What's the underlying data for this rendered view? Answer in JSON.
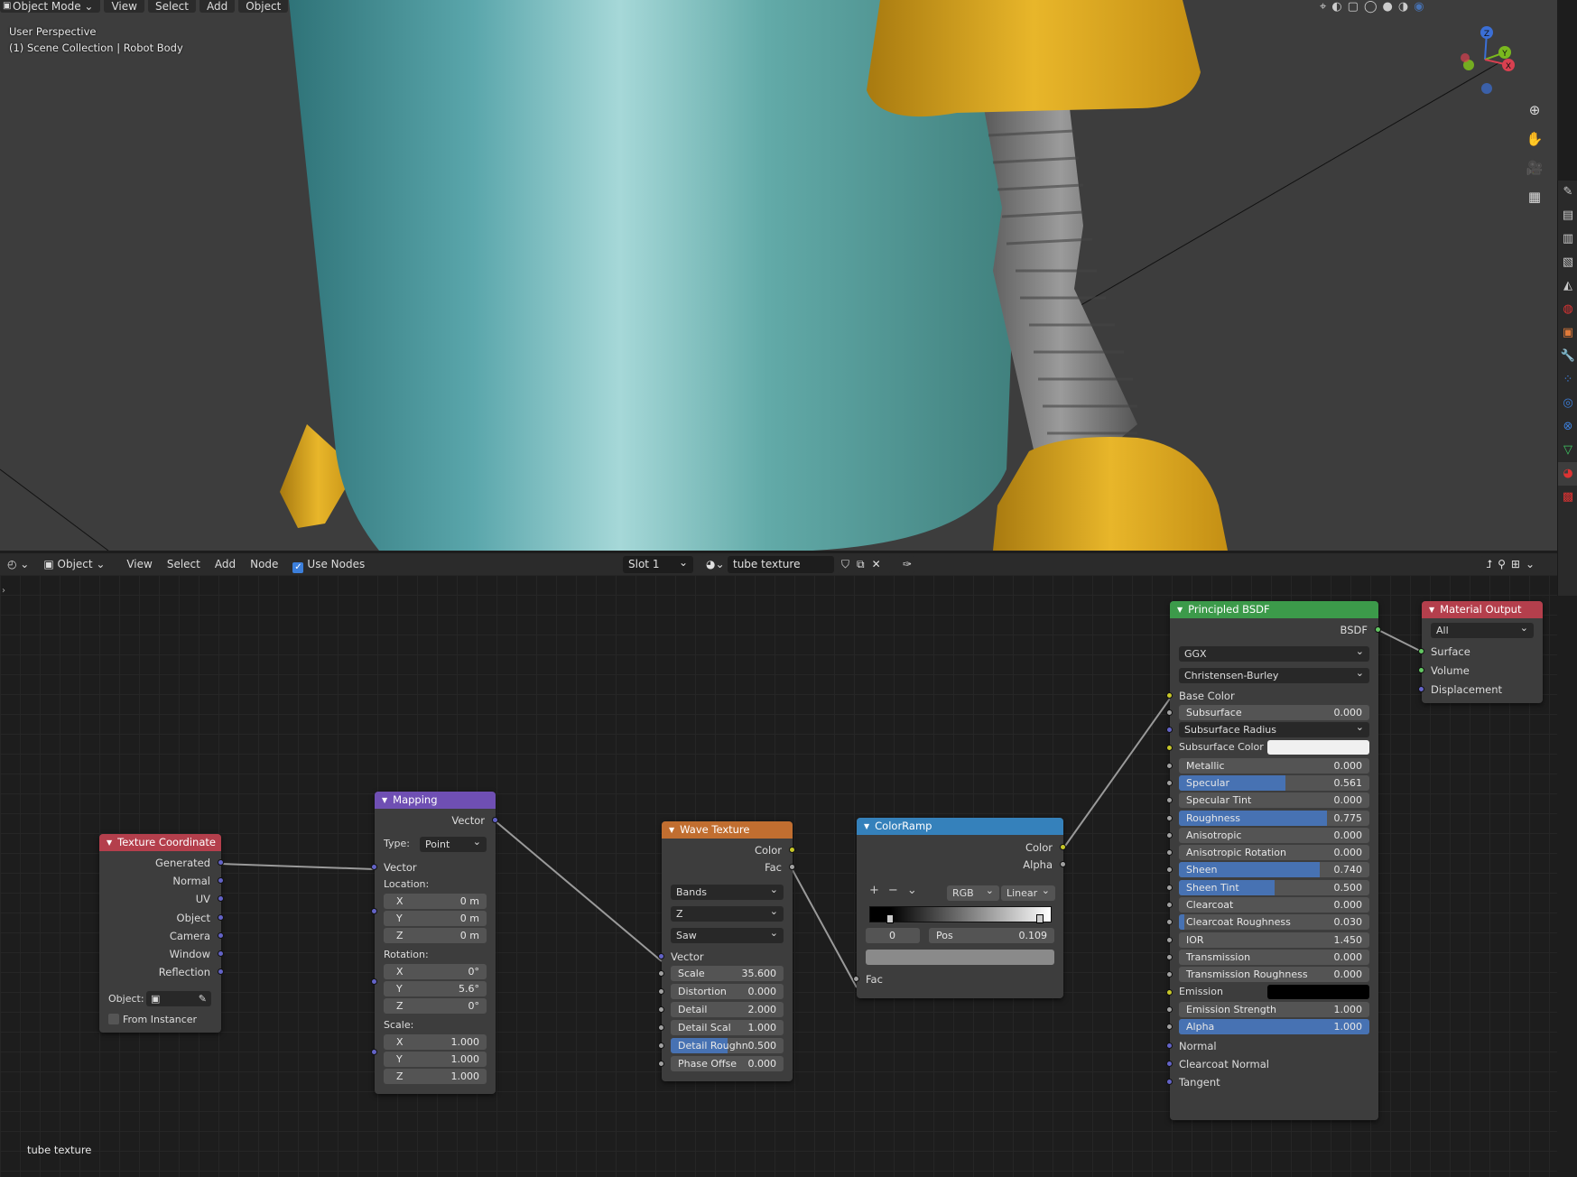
{
  "viewport": {
    "header": {
      "mode": "Object Mode",
      "menus": [
        "View",
        "Select",
        "Add",
        "Object"
      ]
    },
    "overlay": {
      "line1": "User Perspective",
      "line2": "(1) Scene Collection | Robot Body"
    },
    "gizmo": {
      "z": "Z",
      "y": "Y",
      "x": "X"
    },
    "colors": {
      "body": "#5aa6ab",
      "gold": "#d6a21e",
      "screw": "#7e7e7e",
      "bg": "#3d3d3d"
    }
  },
  "node_header": {
    "editor_icon": "shader-editor-icon",
    "object_label": "Object",
    "menus": [
      "View",
      "Select",
      "Add",
      "Node"
    ],
    "use_nodes_label": "Use Nodes",
    "use_nodes": true,
    "slot": "Slot 1",
    "material_name": "tube texture"
  },
  "status": {
    "material": "tube texture"
  },
  "nodes": {
    "texcoord": {
      "title": "Texture Coordinate",
      "color": "#b43f4c",
      "outputs": [
        "Generated",
        "Normal",
        "UV",
        "Object",
        "Camera",
        "Window",
        "Reflection"
      ],
      "object_label": "Object:",
      "from_instancer": "From Instancer"
    },
    "mapping": {
      "title": "Mapping",
      "color": "#6f4fb3",
      "output": "Vector",
      "type_label": "Type:",
      "type_value": "Point",
      "input": "Vector",
      "location_label": "Location:",
      "rotation_label": "Rotation:",
      "scale_label": "Scale:",
      "location": [
        {
          "axis": "X",
          "value": "0 m"
        },
        {
          "axis": "Y",
          "value": "0 m"
        },
        {
          "axis": "Z",
          "value": "0 m"
        }
      ],
      "rotation": [
        {
          "axis": "X",
          "value": "0°"
        },
        {
          "axis": "Y",
          "value": "5.6°"
        },
        {
          "axis": "Z",
          "value": "0°"
        }
      ],
      "scale": [
        {
          "axis": "X",
          "value": "1.000"
        },
        {
          "axis": "Y",
          "value": "1.000"
        },
        {
          "axis": "Z",
          "value": "1.000"
        }
      ]
    },
    "wave": {
      "title": "Wave Texture",
      "color": "#c16e30",
      "outputs": [
        "Color",
        "Fac"
      ],
      "type": "Bands",
      "direction": "Z",
      "profile": "Saw",
      "input": "Vector",
      "params": [
        {
          "label": "Scale",
          "value": "35.600",
          "fill": 0
        },
        {
          "label": "Distortion",
          "value": "0.000",
          "fill": 0
        },
        {
          "label": "Detail",
          "value": "2.000",
          "fill": 0
        },
        {
          "label": "Detail Scal",
          "value": "1.000",
          "fill": 0
        },
        {
          "label": "Detail Roughn",
          "value": "0.500",
          "fill": 0.5
        },
        {
          "label": "Phase Offse",
          "value": "0.000",
          "fill": 0
        }
      ]
    },
    "colorramp": {
      "title": "ColorRamp",
      "color": "#3581bb",
      "outputs": [
        "Color",
        "Alpha"
      ],
      "color_mode": "RGB",
      "interpolation": "Linear",
      "index": "0",
      "pos_label": "Pos",
      "pos_value": "0.109",
      "input": "Fac"
    },
    "bsdf": {
      "title": "Principled BSDF",
      "color": "#3c9a4a",
      "output": "BSDF",
      "distribution": "GGX",
      "subsurface_method": "Christensen-Burley",
      "base_color": "Base Color",
      "params": [
        {
          "label": "Subsurface",
          "value": "0.000",
          "fill": 0,
          "sock": "grey"
        },
        {
          "label": "Subsurface Radius",
          "dropdown": true,
          "sock": "blue"
        },
        {
          "label": "Subsurface Color",
          "swatch": "#f0f0f0",
          "sock": "yel"
        },
        {
          "label": "Metallic",
          "value": "0.000",
          "fill": 0,
          "sock": "grey"
        },
        {
          "label": "Specular",
          "value": "0.561",
          "fill": 0.561,
          "sock": "grey"
        },
        {
          "label": "Specular Tint",
          "value": "0.000",
          "fill": 0,
          "sock": "grey"
        },
        {
          "label": "Roughness",
          "value": "0.775",
          "fill": 0.775,
          "sock": "grey"
        },
        {
          "label": "Anisotropic",
          "value": "0.000",
          "fill": 0,
          "sock": "grey"
        },
        {
          "label": "Anisotropic Rotation",
          "value": "0.000",
          "fill": 0,
          "sock": "grey"
        },
        {
          "label": "Sheen",
          "value": "0.740",
          "fill": 0.74,
          "sock": "grey"
        },
        {
          "label": "Sheen Tint",
          "value": "0.500",
          "fill": 0.5,
          "sock": "grey"
        },
        {
          "label": "Clearcoat",
          "value": "0.000",
          "fill": 0,
          "sock": "grey"
        },
        {
          "label": "Clearcoat Roughness",
          "value": "0.030",
          "fill": 0.03,
          "sock": "grey"
        },
        {
          "label": "IOR",
          "value": "1.450",
          "fill": 0,
          "sock": "grey"
        },
        {
          "label": "Transmission",
          "value": "0.000",
          "fill": 0,
          "sock": "grey"
        },
        {
          "label": "Transmission Roughness",
          "value": "0.000",
          "fill": 0,
          "sock": "grey"
        },
        {
          "label": "Emission",
          "swatch": "#000000",
          "sock": "yel"
        },
        {
          "label": "Emission Strength",
          "value": "1.000",
          "fill": 0,
          "sock": "grey"
        },
        {
          "label": "Alpha",
          "value": "1.000",
          "fill": 1,
          "sock": "grey"
        }
      ],
      "vectors": [
        "Normal",
        "Clearcoat Normal",
        "Tangent"
      ]
    },
    "output": {
      "title": "Material Output",
      "color": "#b43f4c",
      "target": "All",
      "inputs": [
        "Surface",
        "Volume",
        "Displacement"
      ]
    }
  }
}
